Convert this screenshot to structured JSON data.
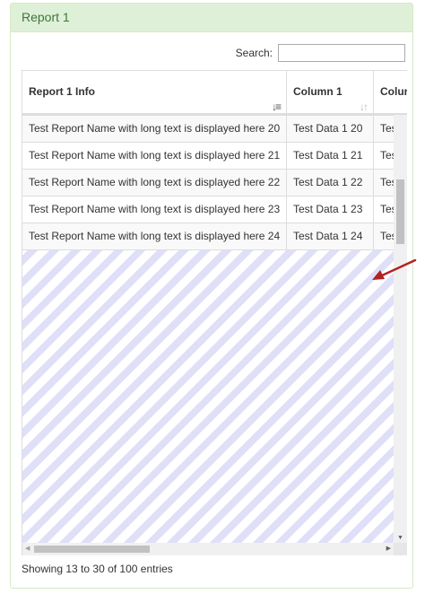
{
  "panel": {
    "title": "Report 1"
  },
  "search": {
    "label": "Search:",
    "value": ""
  },
  "table": {
    "columns": [
      "Report 1 Info",
      "Column 1",
      "Colur"
    ],
    "rows": [
      [
        "Test Report Name with long text is displayed here 20",
        "Test Data 1 20",
        "Tes"
      ],
      [
        "Test Report Name with long text is displayed here 21",
        "Test Data 1 21",
        "Tes"
      ],
      [
        "Test Report Name with long text is displayed here 22",
        "Test Data 1 22",
        "Tes"
      ],
      [
        "Test Report Name with long text is displayed here 23",
        "Test Data 1 23",
        "Tes"
      ],
      [
        "Test Report Name with long text is displayed here 24",
        "Test Data 1 24",
        "Tes"
      ]
    ]
  },
  "footer": {
    "info": "Showing 13 to 30 of 100 entries"
  },
  "colors": {
    "panel_heading_bg": "#dff0d8",
    "panel_heading_text": "#3c763d",
    "annotation_arrow": "#b22222",
    "empty_area_stripe": "#dfe0f7"
  },
  "icons": {
    "sort_active": "sort-amount-down-icon",
    "sort_inactive": "sort-both-icon",
    "annotation": "red-arrow-icon"
  }
}
